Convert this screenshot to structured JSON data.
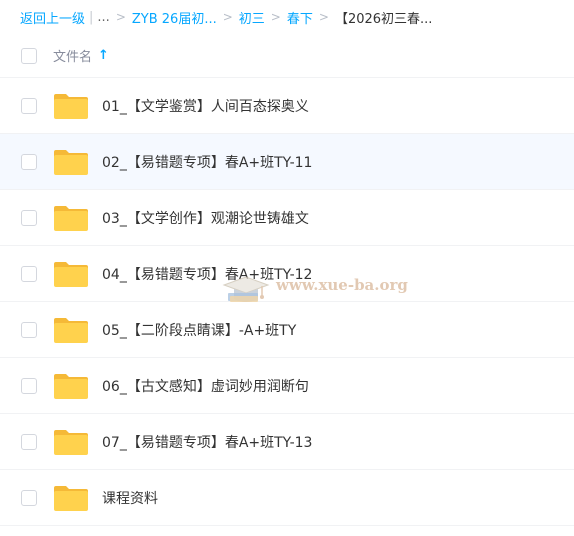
{
  "breadcrumb": {
    "back": "返回上一级",
    "ellipsis": "...",
    "items": [
      "ZYB 26届初...",
      "初三",
      "春下"
    ],
    "current": "【2026初三春..."
  },
  "header": {
    "name_label": "文件名",
    "sort_icon": "arrow-up-icon"
  },
  "files": [
    {
      "name": "01_【文学鉴赏】人间百态探奥义",
      "type": "folder"
    },
    {
      "name": "02_【易错题专项】春A+班TY-11",
      "type": "folder"
    },
    {
      "name": "03_【文学创作】观潮论世铸雄文",
      "type": "folder"
    },
    {
      "name": "04_【易错题专项】春A+班TY-12",
      "type": "folder"
    },
    {
      "name": "05_【二阶段点睛课】-A+班TY",
      "type": "folder"
    },
    {
      "name": "06_【古文感知】虚词妙用润断句",
      "type": "folder"
    },
    {
      "name": "07_【易错题专项】春A+班TY-13",
      "type": "folder"
    },
    {
      "name": "课程资料",
      "type": "folder"
    }
  ],
  "watermark": {
    "text": "www.xue-ba.org"
  },
  "colors": {
    "accent": "#06a7ff",
    "folder": "#ffd24d",
    "folder_tab": "#f5b937"
  }
}
